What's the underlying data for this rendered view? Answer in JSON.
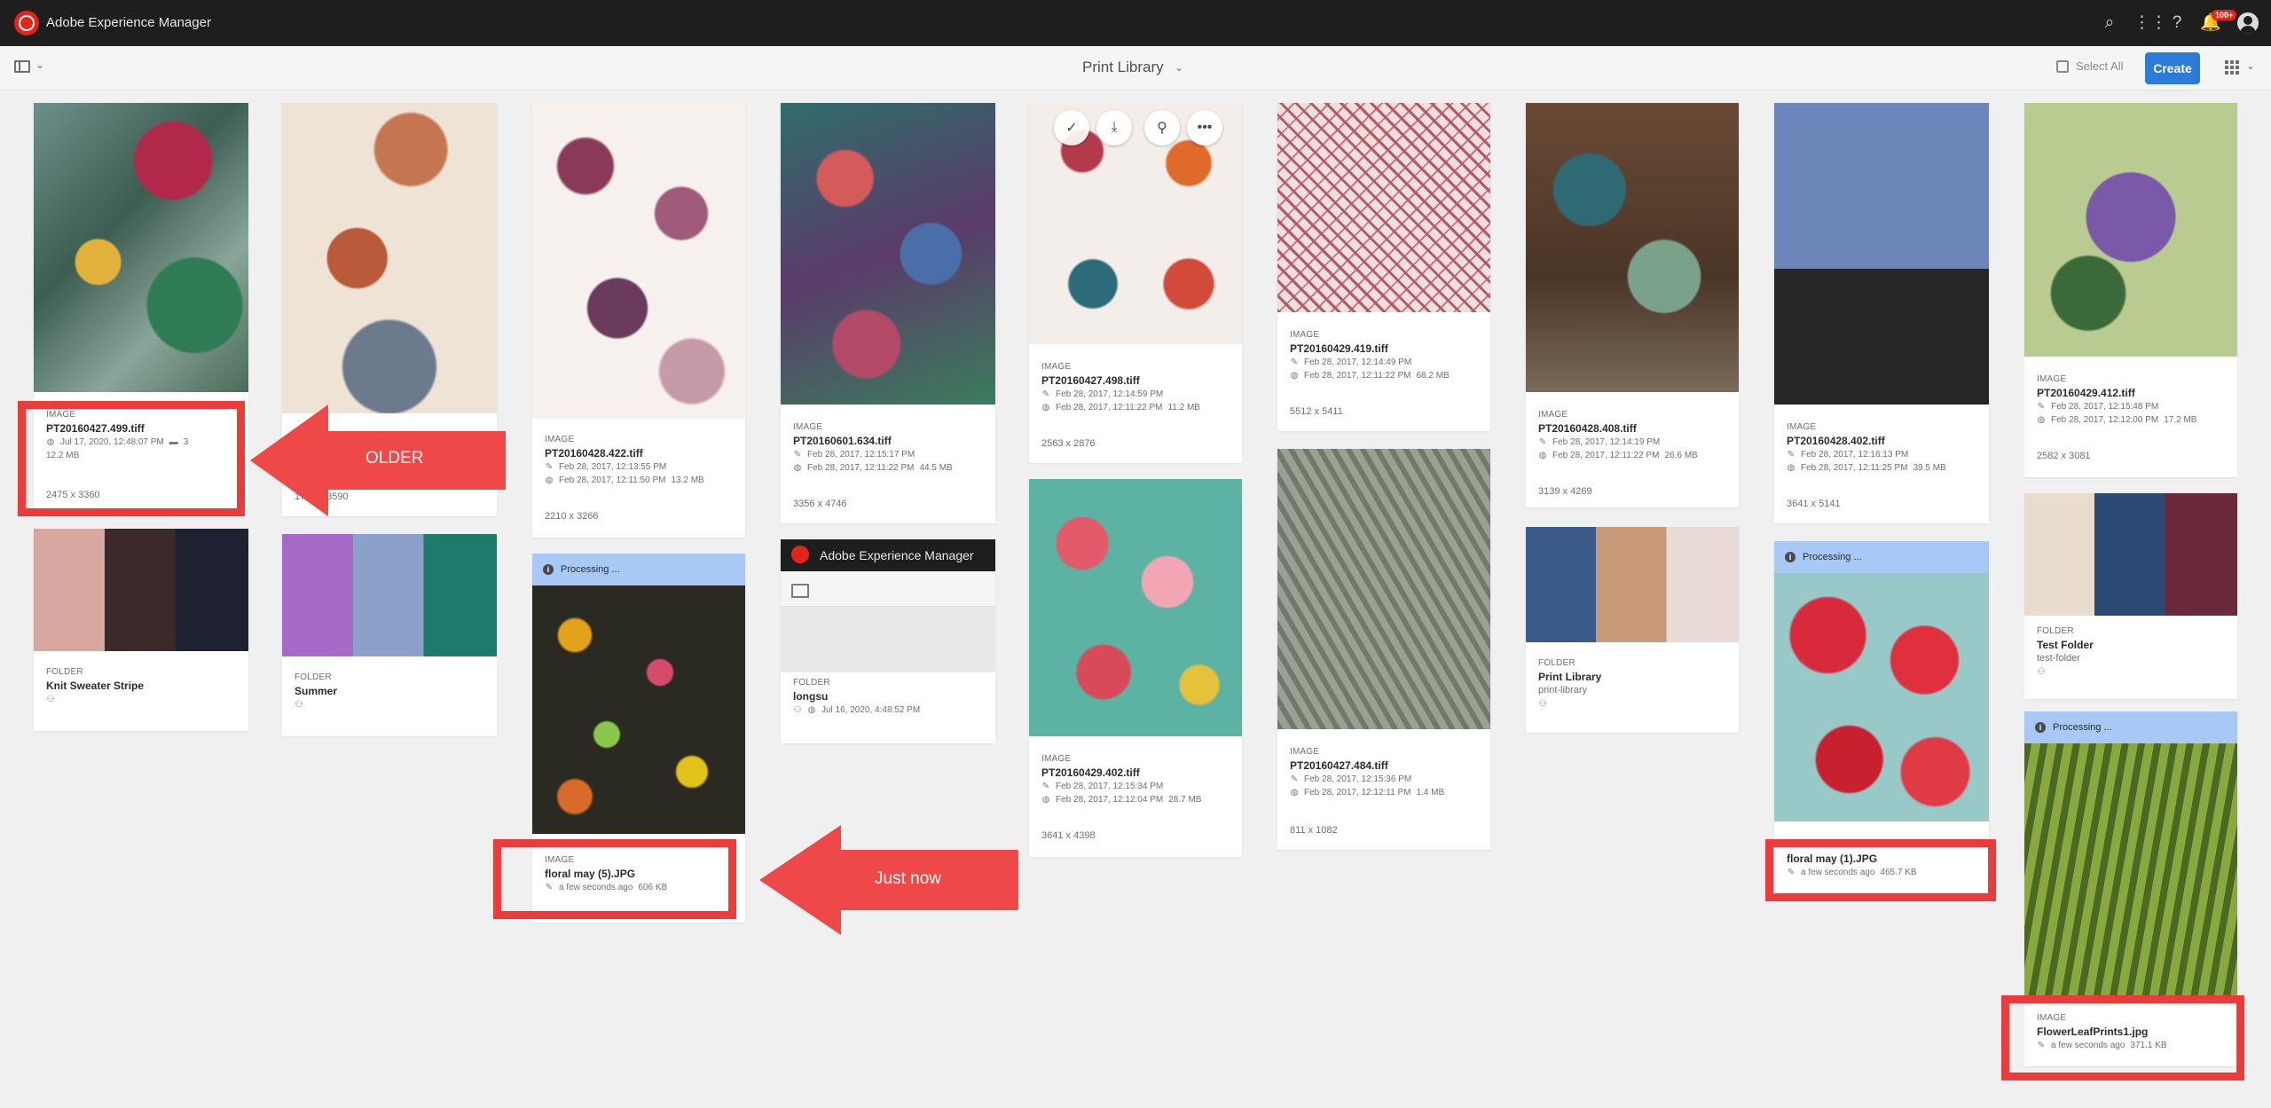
{
  "header": {
    "app_title": "Adobe Experience Manager",
    "notifications_badge": "100+"
  },
  "actionbar": {
    "title": "Print Library",
    "select_all": "Select All",
    "create": "Create"
  },
  "cards": {
    "c1": {
      "type": "IMAGE",
      "name": "PT20160427.499.tiff",
      "date": "Jul 17, 2020, 12:48:07 PM",
      "comments": "3",
      "size": "12.2 MB",
      "dims": "2475 x 3360"
    },
    "c2": {
      "dims": "1750 x 3590"
    },
    "c3": {
      "type": "IMAGE",
      "name": "PT20160428.422.tiff",
      "modified": "Feb 28, 2017, 12:13:55 PM",
      "published": "Feb 28, 2017, 12:11:50 PM",
      "size": "13.2 MB",
      "dims": "2210 x 3266"
    },
    "c4": {
      "type": "IMAGE",
      "name": "PT20160601.634.tiff",
      "modified": "Feb 28, 2017, 12:15:17 PM",
      "published": "Feb 28, 2017, 12:11:22 PM",
      "size": "44.5 MB",
      "dims": "3356 x 4746"
    },
    "c5": {
      "type": "IMAGE",
      "name": "PT20160427.498.tiff",
      "modified": "Feb 28, 2017, 12:14:59 PM",
      "published": "Feb 28, 2017, 12:11:22 PM",
      "size": "11.2 MB",
      "dims": "2563 x 2876"
    },
    "c6": {
      "type": "IMAGE",
      "name": "PT20160429.419.tiff",
      "modified": "Feb 28, 2017, 12:14:49 PM",
      "published": "Feb 28, 2017, 12:11:22 PM",
      "size": "68.2 MB",
      "dims": "5512 x 5411"
    },
    "c7": {
      "type": "IMAGE",
      "name": "PT20160428.408.tiff",
      "modified": "Feb 28, 2017, 12:14:19 PM",
      "published": "Feb 28, 2017, 12:11:22 PM",
      "size": "26.6 MB",
      "dims": "3139 x 4269"
    },
    "c8": {
      "type": "IMAGE",
      "name": "PT20160428.402.tiff",
      "modified": "Feb 28, 2017, 12:16:13 PM",
      "published": "Feb 28, 2017, 12:11:25 PM",
      "size": "39.5 MB",
      "dims": "3641 x 5141"
    },
    "c9": {
      "type": "IMAGE",
      "name": "PT20160429.412.tiff",
      "modified": "Feb 28, 2017, 12:15:48 PM",
      "published": "Feb 28, 2017, 12:12:00 PM",
      "size": "17.2 MB",
      "dims": "2582 x 3081"
    },
    "c10": {
      "type": "FOLDER",
      "name": "Knit Sweater Stripe"
    },
    "c11": {
      "type": "FOLDER",
      "name": "Summer"
    },
    "c12": {
      "processing": "Processing ...",
      "type": "IMAGE",
      "name": "floral may (5).JPG",
      "modified": "a few seconds ago",
      "size": "606 KB"
    },
    "c13": {
      "aem_title": "Adobe Experience Manager",
      "type": "FOLDER",
      "name": "longsu",
      "date": "Jul 16, 2020, 4:48:52 PM"
    },
    "c14": {
      "type": "IMAGE",
      "name": "PT20160429.402.tiff",
      "modified": "Feb 28, 2017, 12:15:34 PM",
      "published": "Feb 28, 2017, 12:12:04 PM",
      "size": "28.7 MB",
      "dims": "3641 x 4398"
    },
    "c15": {
      "type": "IMAGE",
      "name": "PT20160427.484.tiff",
      "modified": "Feb 28, 2017, 12:15:36 PM",
      "published": "Feb 28, 2017, 12:12:11 PM",
      "size": "1.4 MB",
      "dims": "811 x 1082"
    },
    "c16": {
      "type": "FOLDER",
      "name": "Print Library",
      "path": "print-library"
    },
    "c17": {
      "processing": "Processing ...",
      "type": "IMAGE",
      "name": "floral may (1).JPG",
      "modified": "a few seconds ago",
      "size": "465.7 KB"
    },
    "c18": {
      "type": "FOLDER",
      "name": "Test Folder",
      "path": "test-folder"
    },
    "c19": {
      "processing": "Processing ...",
      "type": "IMAGE",
      "name": "FlowerLeafPrints1.jpg",
      "modified": "a few seconds ago",
      "size": "371.1 KB"
    }
  },
  "annotations": {
    "older": "OLDER",
    "just_now": "Just now"
  }
}
